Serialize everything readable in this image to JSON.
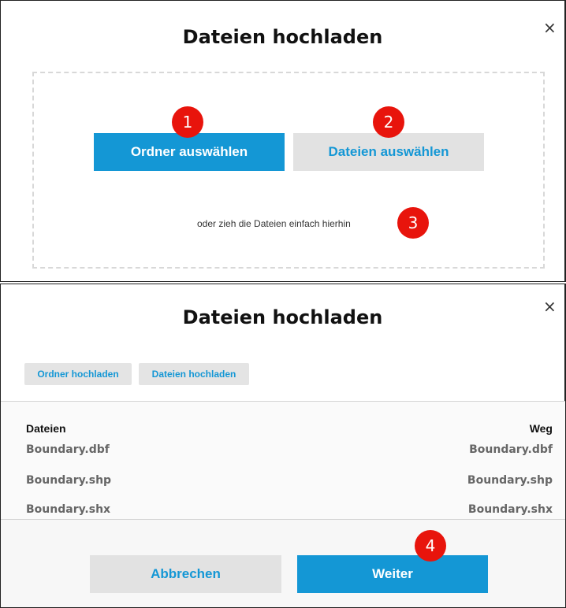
{
  "dialog_select": {
    "title": "Dateien hochladen",
    "close_glyph": "×",
    "select_folder_label": "Ordner auswählen",
    "select_files_label": "Dateien auswählen",
    "drop_hint": "oder zieh die Dateien einfach hierhin"
  },
  "dialog_list": {
    "title": "Dateien hochladen",
    "close_glyph": "×",
    "upload_folder_label": "Ordner hochladen",
    "upload_files_label": "Dateien hochladen",
    "columns": {
      "files": "Dateien",
      "path": "Weg"
    },
    "rows": [
      {
        "file": "Boundary.dbf",
        "path": "Boundary.dbf"
      },
      {
        "file": "Boundary.shp",
        "path": "Boundary.shp"
      },
      {
        "file": "Boundary.shx",
        "path": "Boundary.shx"
      }
    ],
    "cancel_label": "Abbrechen",
    "next_label": "Weiter"
  },
  "annotations": {
    "step1": "1",
    "step2": "2",
    "step3": "3",
    "step4": "4"
  },
  "colors": {
    "primary": "#1497d5",
    "secondary_bg": "#e2e2e2",
    "badge": "#e8140c"
  }
}
